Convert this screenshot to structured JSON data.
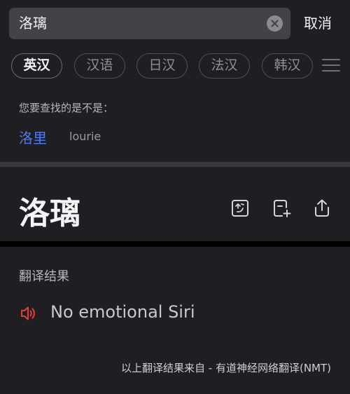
{
  "search": {
    "query": "洛璃",
    "cancel_label": "取消"
  },
  "tabs": [
    {
      "label": "英汉",
      "active": true
    },
    {
      "label": "汉语",
      "active": false
    },
    {
      "label": "日汉",
      "active": false
    },
    {
      "label": "法汉",
      "active": false
    },
    {
      "label": "韩汉",
      "active": false
    }
  ],
  "suggestion": {
    "title": "您要查找的是不是：",
    "word": "洛里",
    "pronunciation": "lourie"
  },
  "entry": {
    "headword": "洛璃"
  },
  "translation": {
    "section_title": "翻译结果",
    "text": "No emotional Siri",
    "source": "以上翻译结果来自 - 有道神经网络翻译(NMT)"
  },
  "colors": {
    "link": "#4c7cf2",
    "speaker": "#e0413a",
    "background": "#1f1f23"
  },
  "icons": {
    "clear": "clear-icon",
    "menu": "menu-icon",
    "speaker": "speaker-icon"
  }
}
